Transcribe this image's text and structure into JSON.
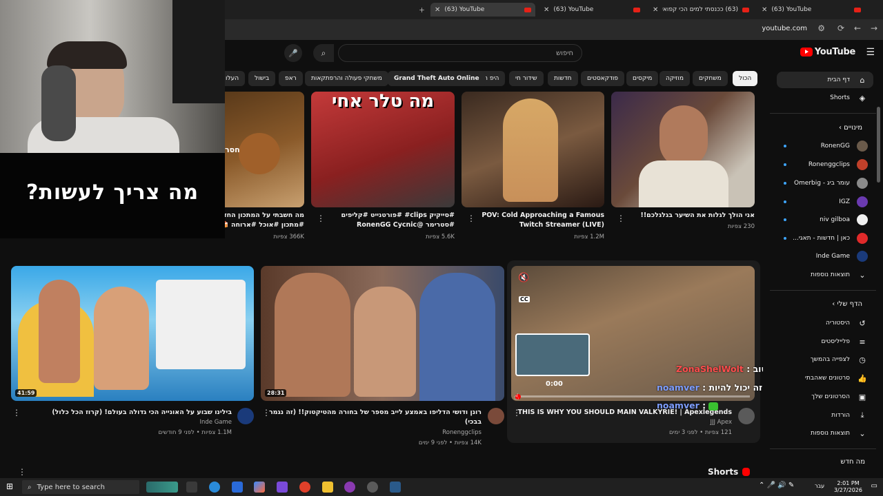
{
  "browser": {
    "tabs": [
      {
        "title": "(63) YouTube",
        "active": true
      },
      {
        "title": "(63) YouTube",
        "active": false
      },
      {
        "title": "(63) ככנסתי למים הכי קפואים בעולם",
        "active": false
      },
      {
        "title": "(63) YouTube",
        "active": false
      }
    ],
    "url": "youtube.com"
  },
  "header": {
    "logo_text": "YouTube",
    "search_placeholder": "חיפוש"
  },
  "chips": [
    "הכול",
    "משחקים",
    "מוזיקה",
    "מיקסים",
    "פודקאסטים",
    "חדשות",
    "שידור חי",
    "היפ הופ",
    "Grand Theft Auto Online",
    "משחקי פעולה והרפתקאות",
    "ראפ",
    "בישול",
    "העלו"
  ],
  "top_row": [
    {
      "title": "אני הולך לגלות את השיער בגלגלכם!!",
      "views": "230 צפיות",
      "title2": ""
    },
    {
      "title": "POV: Cold Approaching a Famous",
      "title2": "Twitch Streamer (LIVE)",
      "views": "1.2M צפיות"
    },
    {
      "title": "#סייקיק clips# #פורטנייט #קליפים",
      "title2": "#סטרימר @RonenGG Cycnic",
      "views": "5.6K צפיות",
      "thumb_text": "מה טלר אחי"
    },
    {
      "title": "מה חשבתי על המתכון החדש",
      "title2": "#מתכון #אוכל #ארוחה 🍰",
      "views": "366K צפיות",
      "thumb_text": "חסר"
    }
  ],
  "bottom_row": [
    {
      "title": "THIS IS WHY YOU SHOULD MAIN VALKYRIE! | Apexlegends",
      "channel": "JJJ Apex",
      "meta": "121 צפיות • לפני 3 ימים",
      "preview_time": "0:00"
    },
    {
      "title": "רונן ודושי הדליפו באמצע לייב מספר של בחורה מהטיקטוק!! (זה נגמר",
      "title2": "בבכי)",
      "channel": "Ronenggclips",
      "meta": "14K צפיות • לפני 9 ימים",
      "duration": "28:31"
    },
    {
      "title": "בילינו שבוע על האונייה הכי גדולה בעולם! (קרוז הכל כלול)",
      "channel": "Inde Game",
      "meta": "1.1M צפיות • לפני 9 חודשים",
      "duration": "41:59"
    }
  ],
  "shorts_label": "Shorts",
  "sidebar": {
    "home": "דף הבית",
    "shorts": "Shorts",
    "subs_header": "מינויים",
    "subs": [
      "RonenGG",
      "Ronenggclips",
      "עומר ביג - Omerbig",
      "IGZ",
      "niv gilboa",
      "כאן | חדשות - תאגי...",
      "Inde Game"
    ],
    "show_more": "תוצאות נוספות",
    "you_header": "הדף שלי",
    "you_items": [
      "היסטוריה",
      "פלייליסטים",
      "לצפייה בהמשך",
      "סרטונים שאהבתי",
      "הסרטונים שלך",
      "הורדות",
      "תוצאות נוספות"
    ],
    "whats_new": "מה חדש"
  },
  "stream": {
    "caption": "מה צריך לעשות?",
    "chat": [
      {
        "user": "ZonaShelWolt",
        "text": "אני טוב",
        "color": "#ff4d4d"
      },
      {
        "user": "noamver",
        "text": "קטינה מי זה יכול להיות",
        "color": "#7d9dff"
      },
      {
        "user": "noamver",
        "text": "",
        "color": "#7d9dff"
      }
    ]
  },
  "taskbar": {
    "search_placeholder": "Type here to search",
    "time": "2:01 PM",
    "date": "3/27/2026",
    "lang": "עבר"
  }
}
